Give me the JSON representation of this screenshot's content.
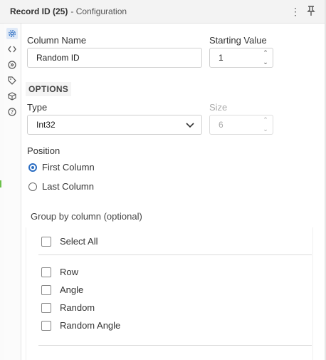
{
  "header": {
    "title": "Record ID (25)",
    "subtitle": "- Configuration",
    "menu_icon": "kebab-menu-icon",
    "pin_icon": "pin-icon"
  },
  "sidebar": {
    "icons": [
      "gear-icon",
      "code-icon",
      "connection-icon",
      "tag-icon",
      "cube-icon",
      "help-icon"
    ]
  },
  "form": {
    "column_name_label": "Column Name",
    "column_name_value": "Random ID",
    "starting_value_label": "Starting Value",
    "starting_value": "1",
    "options_heading": "OPTIONS",
    "type_label": "Type",
    "type_value": "Int32",
    "size_label": "Size",
    "size_value": "6",
    "position_label": "Position",
    "position_options": [
      "First Column",
      "Last Column"
    ],
    "position_selected": "First Column"
  },
  "group_by": {
    "label": "Group by column (optional)",
    "select_all": "Select All",
    "columns": [
      "Row",
      "Angle",
      "Random",
      "Random Angle"
    ]
  },
  "colors": {
    "accent": "#2b6dc2",
    "active_icon_bg": "#dfe9f7"
  }
}
